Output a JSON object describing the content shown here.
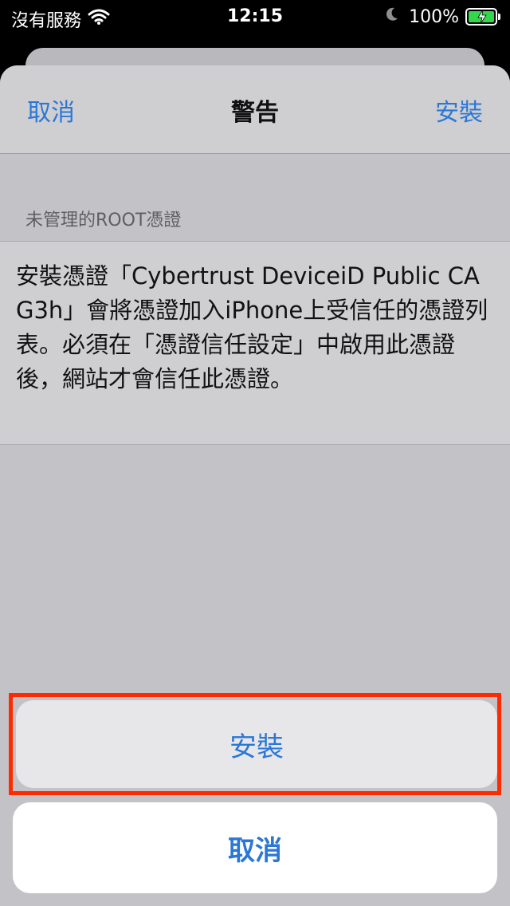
{
  "status_bar": {
    "carrier": "沒有服務",
    "time": "12:15",
    "battery_percent": "100%"
  },
  "nav": {
    "cancel_label": "取消",
    "title": "警告",
    "install_label": "安裝"
  },
  "section_header": "未管理的ROOT憑證",
  "body_text": "安裝憑證「Cybertrust DeviceiD Public CA G3h」會將憑證加入iPhone上受信任的憑證列表。必須在「憑證信任設定」中啟用此憑證後，網站才會信任此憑證。",
  "action_sheet": {
    "install_label": "安裝",
    "cancel_label": "取消"
  },
  "colors": {
    "accent": "#2b77d6",
    "highlight": "#ff2a00",
    "battery": "#32d74b"
  },
  "icons": [
    "wifi-icon",
    "moon-icon",
    "battery-icon",
    "charging-bolt-icon"
  ]
}
